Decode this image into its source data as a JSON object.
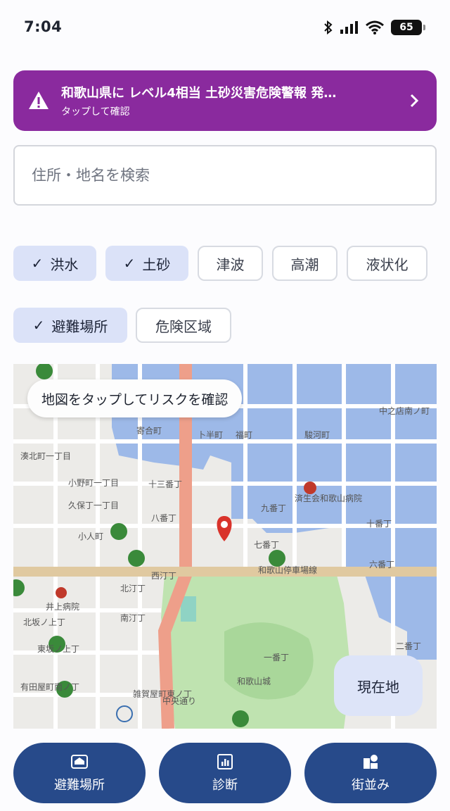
{
  "status_bar": {
    "time": "7:04",
    "battery": "65"
  },
  "alert": {
    "title": "和歌山県に レベル4相当 土砂災害危険警報 発…",
    "subtitle": "タップして確認",
    "color": "#8a2a9e"
  },
  "search": {
    "placeholder": "住所・地名を検索"
  },
  "filters": {
    "row1": [
      {
        "label": "洪水",
        "selected": true
      },
      {
        "label": "土砂",
        "selected": true
      },
      {
        "label": "津波",
        "selected": false
      },
      {
        "label": "高潮",
        "selected": false
      },
      {
        "label": "液状化",
        "selected": false
      }
    ],
    "row2": [
      {
        "label": "避難場所",
        "selected": true
      },
      {
        "label": "危険区域",
        "selected": false
      }
    ]
  },
  "map": {
    "hint": "地図をタップしてリスクを確認",
    "locate_label": "現在地",
    "labels": [
      "寄合町",
      "湊北町一丁目",
      "小野町一丁目",
      "久保丁一丁目",
      "十三番丁",
      "八番丁",
      "小人町",
      "北汀丁",
      "南汀丁",
      "北坂ノ上丁",
      "東坂ノ上丁",
      "有田屋町南ノ丁",
      "雑賀屋町東ノ丁",
      "和歌山城",
      "一番丁",
      "七番丁",
      "九番丁",
      "十番丁",
      "六番丁",
      "駿河町",
      "福町",
      "卜半町",
      "中之店南ノ町",
      "二番丁",
      "済生会和歌山病院",
      "井上病院",
      "西汀丁",
      "和歌山停車場線",
      "中央通り"
    ],
    "flood_color": "#8fb0e8"
  },
  "nav": [
    {
      "label": "避難場所",
      "icon": "shelter-icon"
    },
    {
      "label": "診断",
      "icon": "chart-icon"
    },
    {
      "label": "街並み",
      "icon": "townscape-icon"
    }
  ]
}
